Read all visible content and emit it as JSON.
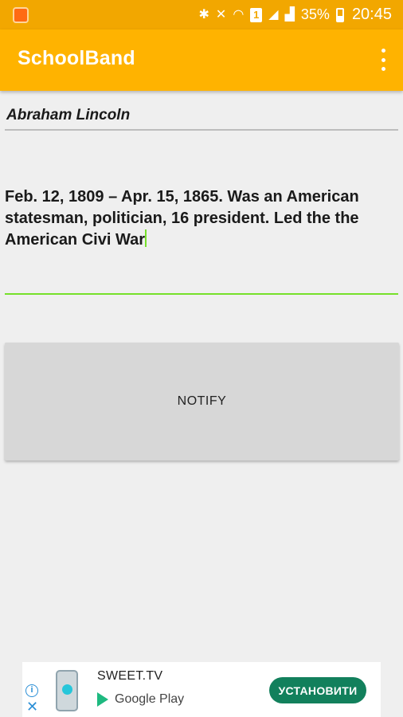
{
  "status_bar": {
    "battery": "35%",
    "time": "20:45",
    "sim": "1"
  },
  "app_bar": {
    "title": "SchoolBand"
  },
  "form": {
    "name_value": "Abraham Lincoln",
    "bio_value": "Feb. 12, 1809 – Apr. 15, 1865. Was an American statesman, politician, 16 president. Led the the American Civi War"
  },
  "notify_button": {
    "label": "NOTIFY"
  },
  "ad": {
    "title": "SWEET.TV",
    "store": "Google Play",
    "install_label": "УСТАНОВИТИ"
  },
  "colors": {
    "appbar": "#ffb300",
    "statusbar": "#f2a700",
    "focus_underline": "#76e02a",
    "install_button": "#12805c"
  }
}
